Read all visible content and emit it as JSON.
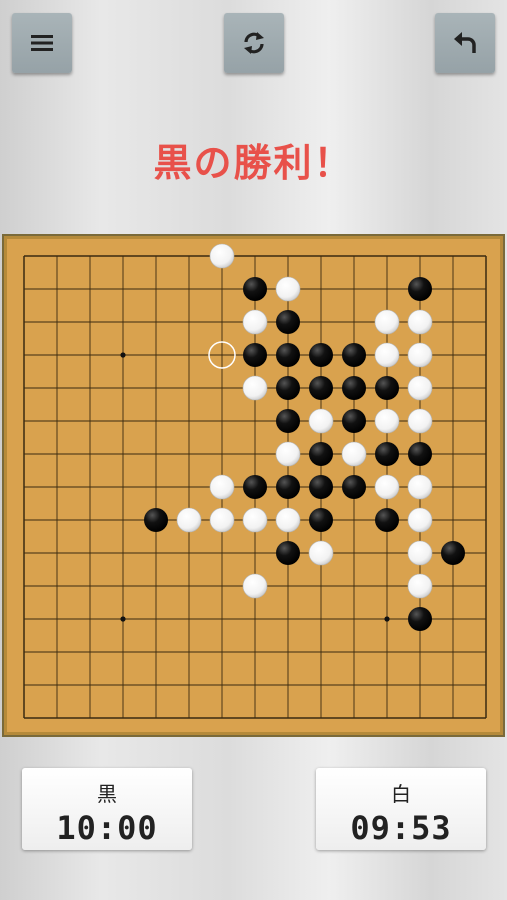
{
  "toolbar": {
    "menu_icon": "hamburger-menu-icon",
    "refresh_icon": "refresh-icon",
    "undo_icon": "undo-arrow-icon"
  },
  "status": {
    "result_text": "黒の勝利！",
    "color": "#e8514a"
  },
  "board": {
    "size": 15,
    "star_points": [
      [
        3,
        3
      ],
      [
        11,
        3
      ],
      [
        3,
        11
      ],
      [
        11,
        11
      ]
    ],
    "last_move": [
      6,
      3
    ],
    "black_stones": [
      [
        7,
        1
      ],
      [
        12,
        1
      ],
      [
        8,
        2
      ],
      [
        7,
        3
      ],
      [
        8,
        3
      ],
      [
        9,
        3
      ],
      [
        10,
        3
      ],
      [
        8,
        4
      ],
      [
        9,
        4
      ],
      [
        10,
        4
      ],
      [
        11,
        4
      ],
      [
        8,
        5
      ],
      [
        10,
        5
      ],
      [
        9,
        6
      ],
      [
        11,
        6
      ],
      [
        12,
        6
      ],
      [
        7,
        7
      ],
      [
        8,
        7
      ],
      [
        9,
        7
      ],
      [
        10,
        7
      ],
      [
        4,
        8
      ],
      [
        9,
        8
      ],
      [
        11,
        8
      ],
      [
        8,
        9
      ],
      [
        13,
        9
      ],
      [
        12,
        11
      ]
    ],
    "white_stones": [
      [
        6,
        0
      ],
      [
        8,
        1
      ],
      [
        7,
        2
      ],
      [
        11,
        2
      ],
      [
        12,
        2
      ],
      [
        11,
        3
      ],
      [
        12,
        3
      ],
      [
        7,
        4
      ],
      [
        12,
        4
      ],
      [
        9,
        5
      ],
      [
        11,
        5
      ],
      [
        12,
        5
      ],
      [
        8,
        6
      ],
      [
        10,
        6
      ],
      [
        6,
        7
      ],
      [
        11,
        7
      ],
      [
        12,
        7
      ],
      [
        5,
        8
      ],
      [
        6,
        8
      ],
      [
        7,
        8
      ],
      [
        8,
        8
      ],
      [
        12,
        8
      ],
      [
        9,
        9
      ],
      [
        12,
        9
      ],
      [
        7,
        10
      ],
      [
        12,
        10
      ]
    ],
    "colors": {
      "wood": "#d9a24e",
      "line": "#3a2a10"
    }
  },
  "clocks": {
    "black": {
      "label": "黒",
      "time": "10:00"
    },
    "white": {
      "label": "白",
      "time": "09:53"
    }
  }
}
